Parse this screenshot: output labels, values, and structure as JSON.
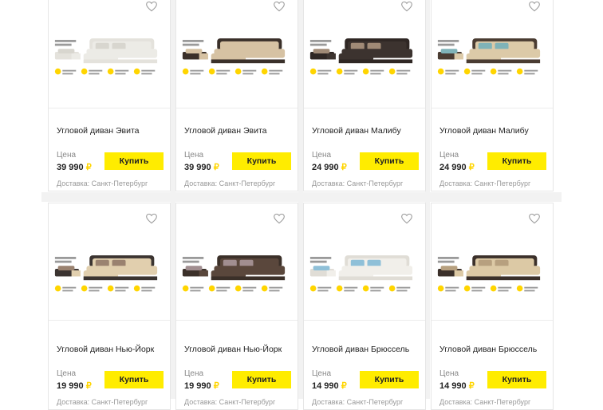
{
  "price_label": "Цена",
  "buy_label": "Купить",
  "currency": "₽",
  "accent": "#ffec00",
  "products": [
    {
      "title": "Угловой диван Эвита",
      "price": "39 990",
      "delivery": "Доставка: Санкт-Петербург",
      "upholstery": "#ecebe6",
      "base": "#e4e2dc",
      "pillow": "#d8d6cf"
    },
    {
      "title": "Угловой диван Эвита",
      "price": "39 990",
      "delivery": "Доставка: Санкт-Петербург",
      "upholstery": "#d6c2a3",
      "base": "#3a302a",
      "pillow": "#d6c2a3"
    },
    {
      "title": "Угловой диван Малибу",
      "price": "24 990",
      "delivery": "Доставка: Санкт-Петербург",
      "upholstery": "#3c332f",
      "base": "#2f2724",
      "pillow": "#a08a76"
    },
    {
      "title": "Угловой диван Малибу",
      "price": "24 990",
      "delivery": "Доставка: Санкт-Петербург",
      "upholstery": "#dccaa8",
      "base": "#4a3c32",
      "pillow": "#7fb3b8"
    },
    {
      "title": "Угловой диван Нью-Йорк",
      "price": "19 990",
      "delivery": "Доставка: Санкт-Петербург",
      "upholstery": "#e1cfae",
      "base": "#3b3431",
      "pillow": "#9a8270"
    },
    {
      "title": "Угловой диван Нью-Йорк",
      "price": "19 990",
      "delivery": "Доставка: Санкт-Петербург",
      "upholstery": "#5a473c",
      "base": "#3b3029",
      "pillow": "#a18e90"
    },
    {
      "title": "Угловой диван Брюссель",
      "price": "14 990",
      "delivery": "Доставка: Санкт-Петербург",
      "upholstery": "#f1efea",
      "base": "#e0ddd6",
      "pillow": "#8fc0d8"
    },
    {
      "title": "Угловой диван Брюссель",
      "price": "14 990",
      "delivery": "Доставка: Санкт-Петербург",
      "upholstery": "#dcc9a5",
      "base": "#3b302a",
      "pillow": "#b7a07f"
    }
  ]
}
